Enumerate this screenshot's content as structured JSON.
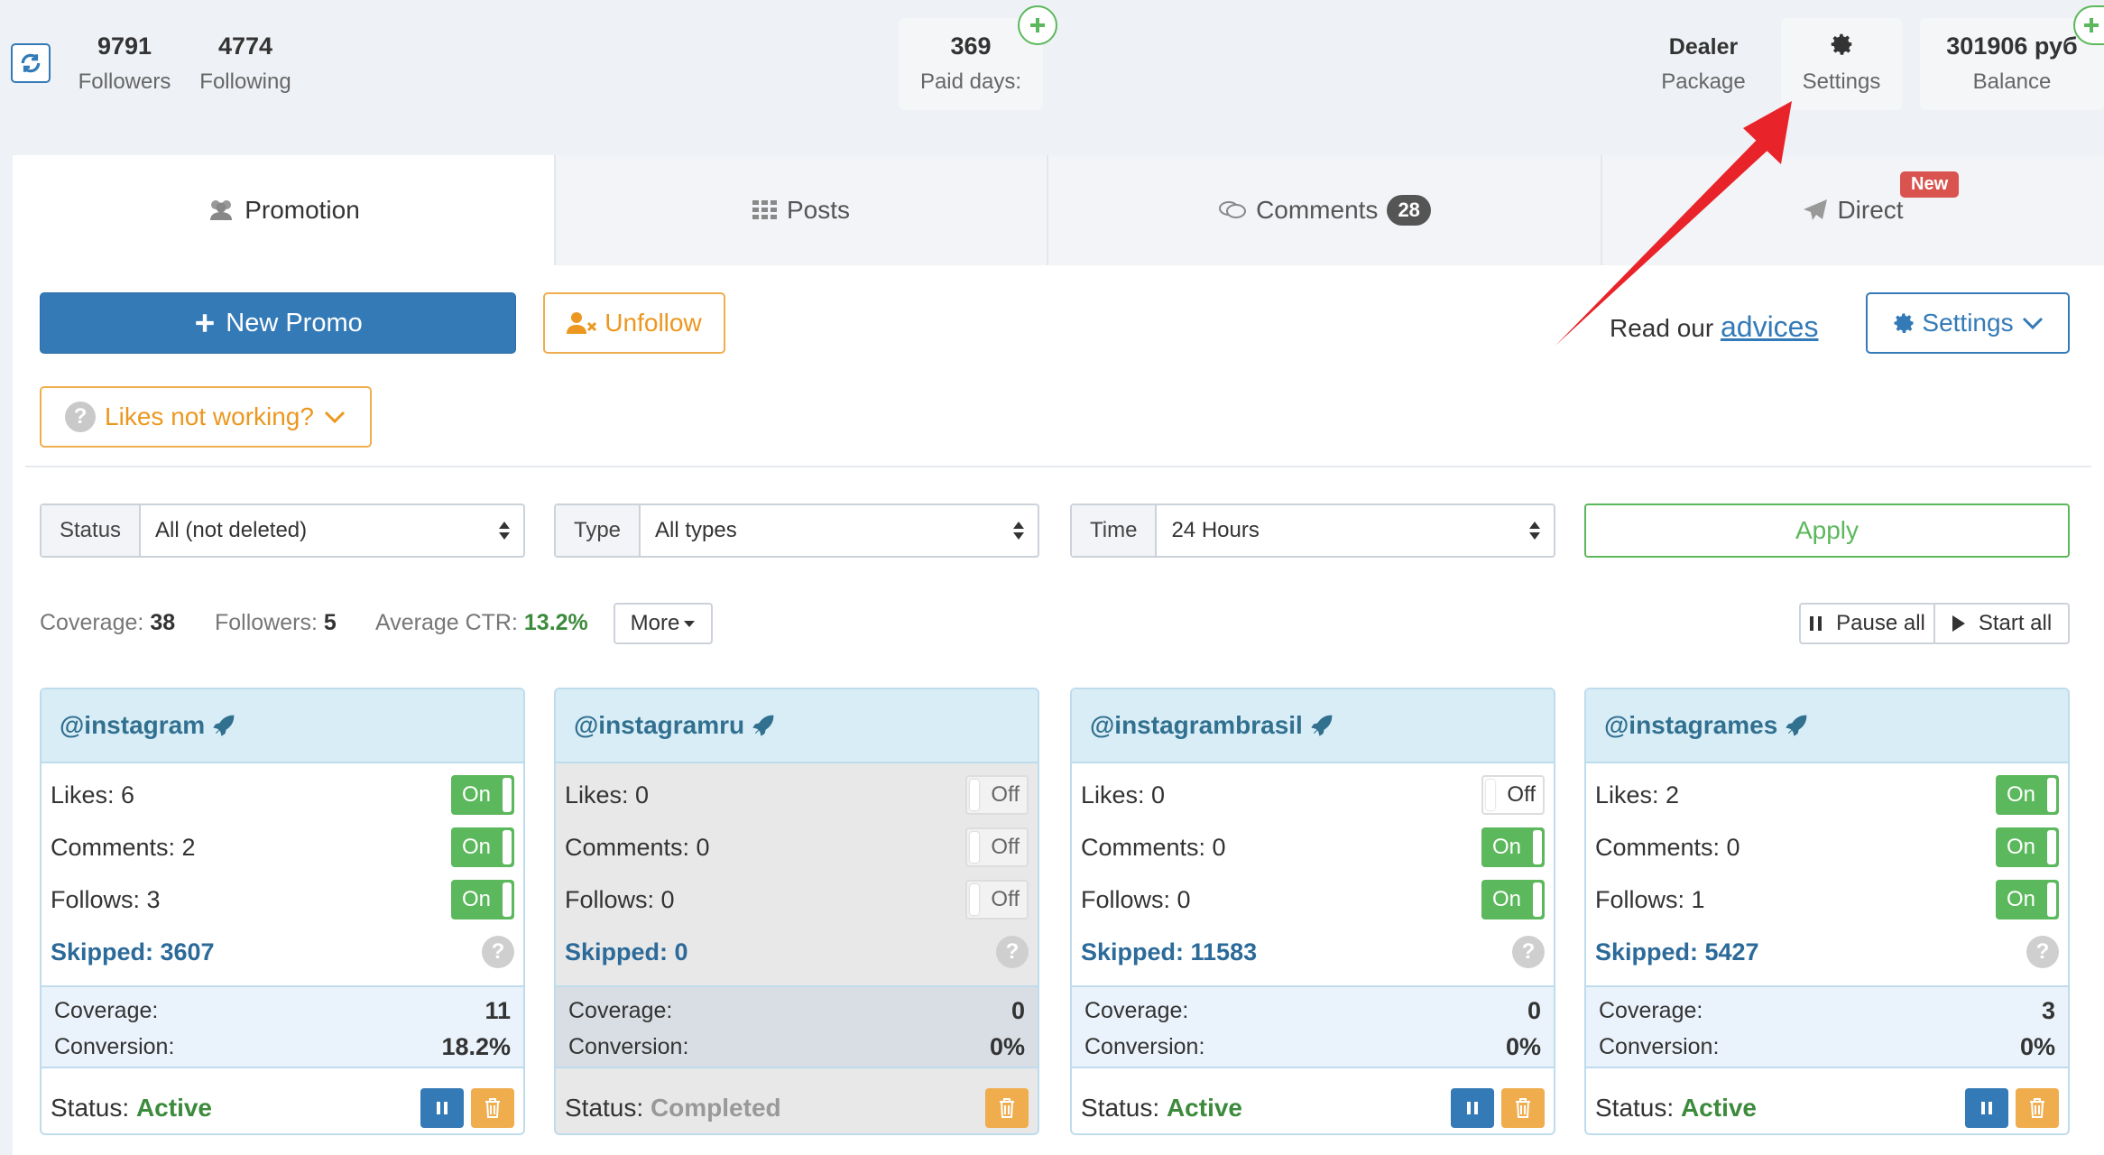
{
  "header": {
    "followers": {
      "value": "9791",
      "label": "Followers"
    },
    "following": {
      "value": "4774",
      "label": "Following"
    },
    "paid_days": {
      "value": "369",
      "label": "Paid days:"
    },
    "package": {
      "value": "Dealer",
      "label": "Package"
    },
    "settings": {
      "label": "Settings"
    },
    "balance": {
      "value": "301906 руб",
      "label": "Balance"
    }
  },
  "tabs": [
    {
      "label": "Promotion"
    },
    {
      "label": "Posts"
    },
    {
      "label": "Comments",
      "badge": "28"
    },
    {
      "label": "Direct",
      "badge": "New"
    }
  ],
  "toolbar": {
    "new_promo": "New Promo",
    "unfollow": "Unfollow",
    "likes_not_working": "Likes not working?",
    "read_our": "Read our",
    "advices": "advices",
    "settings": "Settings"
  },
  "filters": {
    "status": {
      "label": "Status",
      "value": "All (not deleted)"
    },
    "type": {
      "label": "Type",
      "value": "All types"
    },
    "time": {
      "label": "Time",
      "value": "24 Hours"
    },
    "apply": "Apply"
  },
  "summary": {
    "coverage_label": "Coverage:",
    "coverage": "38",
    "followers_label": "Followers:",
    "followers": "5",
    "ctr_label": "Average CTR:",
    "ctr": "13.2%",
    "more": "More",
    "pause_all": "Pause all",
    "start_all": "Start all"
  },
  "cards": [
    {
      "account": "@instagram",
      "likes": "Likes: 6",
      "comments": "Comments: 2",
      "follows": "Follows: 3",
      "likes_toggle": "On",
      "comments_toggle": "On",
      "follows_toggle": "On",
      "skipped": "Skipped: 3607",
      "coverage_label": "Coverage:",
      "coverage": "11",
      "conversion_label": "Conversion:",
      "conversion": "18.2%",
      "status_label": "Status:",
      "status": "Active"
    },
    {
      "account": "@instagramru",
      "likes": "Likes: 0",
      "comments": "Comments: 0",
      "follows": "Follows: 0",
      "likes_toggle": "Off",
      "comments_toggle": "Off",
      "follows_toggle": "Off",
      "skipped": "Skipped: 0",
      "coverage_label": "Coverage:",
      "coverage": "0",
      "conversion_label": "Conversion:",
      "conversion": "0%",
      "status_label": "Status:",
      "status": "Completed"
    },
    {
      "account": "@instagrambrasil",
      "likes": "Likes: 0",
      "comments": "Comments: 0",
      "follows": "Follows: 0",
      "likes_toggle": "Off",
      "comments_toggle": "On",
      "follows_toggle": "On",
      "skipped": "Skipped: 11583",
      "coverage_label": "Coverage:",
      "coverage": "0",
      "conversion_label": "Conversion:",
      "conversion": "0%",
      "status_label": "Status:",
      "status": "Active"
    },
    {
      "account": "@instagrames",
      "likes": "Likes: 2",
      "comments": "Comments: 0",
      "follows": "Follows: 1",
      "likes_toggle": "On",
      "comments_toggle": "On",
      "follows_toggle": "On",
      "skipped": "Skipped: 5427",
      "coverage_label": "Coverage:",
      "coverage": "3",
      "conversion_label": "Conversion:",
      "conversion": "0%",
      "status_label": "Status:",
      "status": "Active"
    }
  ],
  "colors": {
    "primary": "#337ab7",
    "success": "#5cb85c",
    "warning": "#f0ad4e",
    "danger": "#d9534f",
    "arrow": "#e8242a"
  }
}
